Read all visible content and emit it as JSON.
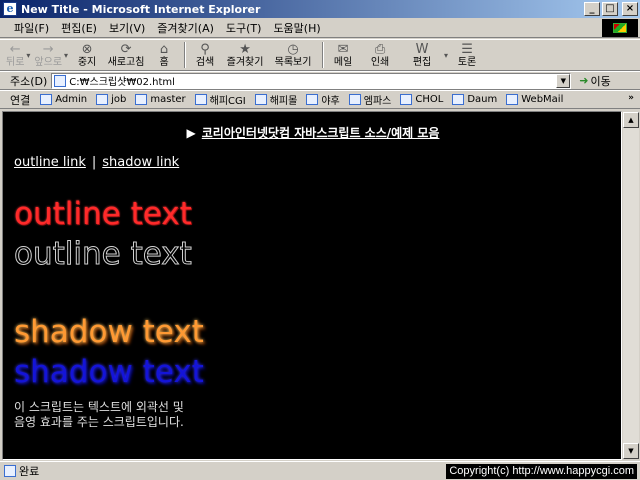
{
  "window": {
    "title": "New Title - Microsoft Internet Explorer",
    "app_icon": "e",
    "minimize_glyph": "_",
    "maximize_glyph": "□",
    "close_glyph": "×"
  },
  "menu": {
    "items": [
      "파일(F)",
      "편집(E)",
      "보기(V)",
      "즐겨찾기(A)",
      "도구(T)",
      "도움말(H)"
    ]
  },
  "toolbar": {
    "buttons": [
      {
        "label": "뒤로",
        "icon": "back-arrow-icon",
        "glyph": "←"
      },
      {
        "label": "앞으로",
        "icon": "forward-arrow-icon",
        "glyph": "→"
      },
      {
        "label": "중지",
        "icon": "stop-icon",
        "glyph": "⊗"
      },
      {
        "label": "새로고침",
        "icon": "refresh-icon",
        "glyph": "⟳"
      },
      {
        "label": "홈",
        "icon": "home-icon",
        "glyph": "⌂"
      },
      {
        "label": "검색",
        "icon": "search-icon",
        "glyph": "⚲"
      },
      {
        "label": "즐겨찾기",
        "icon": "favorites-icon",
        "glyph": "★"
      },
      {
        "label": "목록보기",
        "icon": "history-icon",
        "glyph": "◷"
      },
      {
        "label": "메일",
        "icon": "mail-icon",
        "glyph": "✉"
      },
      {
        "label": "인쇄",
        "icon": "print-icon",
        "glyph": "⎙"
      },
      {
        "label": "편집",
        "icon": "edit-icon",
        "glyph": "W"
      },
      {
        "label": "토론",
        "icon": "discuss-icon",
        "glyph": "☰"
      }
    ],
    "dropdown_glyph": "▾"
  },
  "address": {
    "label": "주소(D)",
    "value": "C:₩스크립샷₩02.html",
    "dropdown_glyph": "▼",
    "go_label": "이동",
    "go_glyph": "➜"
  },
  "links": {
    "label": "연결",
    "items": [
      "Admin",
      "job",
      "master",
      "해피CGI",
      "해피몰",
      "야후",
      "엠파스",
      "CHOL",
      "Daum",
      "WebMail"
    ],
    "more_glyph": "»"
  },
  "content": {
    "heading_arrow": "▶",
    "heading": "코리아인터넷닷컴 자바스크립트 소스/예제 모음",
    "nav": {
      "outline_link": "outline link",
      "separator": "|",
      "shadow_link": "shadow link"
    },
    "outline_red": "outline text",
    "outline_hollow": "outline text",
    "shadow_orange": "shadow text",
    "shadow_blue": "shadow text",
    "description_line1": "이 스크립트는 텍스트에 외곽선 및",
    "description_line2": "음영 효과를 주는 스크립트입니다.",
    "colors": {
      "background": "#000000",
      "outline_red": "#ff2a2a",
      "shadow_orange": "#ff9933",
      "shadow_blue": "#1414d8"
    }
  },
  "scrollbar": {
    "up_glyph": "▲",
    "down_glyph": "▼"
  },
  "status": {
    "text": "완료",
    "copyright": "Copyright(c) http://www.happycgi.com"
  }
}
